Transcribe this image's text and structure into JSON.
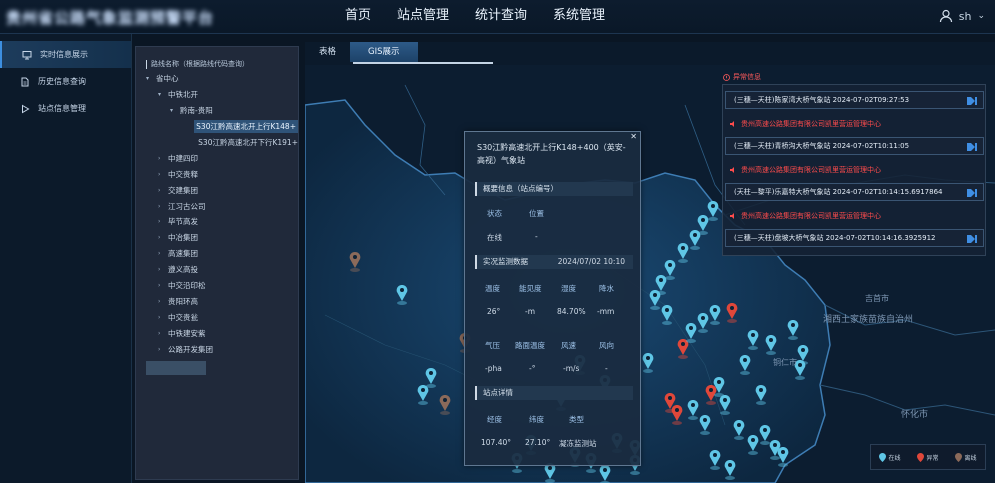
{
  "app": {
    "title": "贵州省公路气象监测预警平台"
  },
  "nav": {
    "items": [
      "首页",
      "站点管理",
      "统计查询",
      "系统管理"
    ]
  },
  "user": {
    "name": "sh"
  },
  "sidebar": {
    "items": [
      {
        "label": "实时信息展示",
        "icon": "monitor-icon"
      },
      {
        "label": "历史信息查询",
        "icon": "document-icon"
      },
      {
        "label": "站点信息管理",
        "icon": "play-icon"
      }
    ]
  },
  "tree": {
    "header": "路线名称（根据路线代码查询）",
    "nodes": [
      {
        "label": "省中心",
        "arrow": "▾"
      },
      {
        "label": "中铁北开",
        "arrow": "▾"
      },
      {
        "label": "黔南-贵阳",
        "arrow": "▾"
      },
      {
        "label": "S30江黔高速北开上行K148+",
        "arrow": ""
      },
      {
        "label": "S30江黔高速北开下行K191+",
        "arrow": ""
      },
      {
        "label": "中建四印",
        "arrow": "›"
      },
      {
        "label": "中交贵释",
        "arrow": "›"
      },
      {
        "label": "交建集团",
        "arrow": "›"
      },
      {
        "label": "江习古公司",
        "arrow": "›"
      },
      {
        "label": "毕节高发",
        "arrow": "›"
      },
      {
        "label": "中冶集团",
        "arrow": "›"
      },
      {
        "label": "高速集团",
        "arrow": "›"
      },
      {
        "label": "遵义高投",
        "arrow": "›"
      },
      {
        "label": "中交沿印松",
        "arrow": "›"
      },
      {
        "label": "贵阳环高",
        "arrow": "›"
      },
      {
        "label": "中交贵瓮",
        "arrow": "›"
      },
      {
        "label": "中铁建安紫",
        "arrow": "›"
      },
      {
        "label": "公路开发集团",
        "arrow": "›"
      }
    ]
  },
  "tabs": [
    "表格",
    "GIS展示"
  ],
  "alerts": {
    "title": "异常信息",
    "rows": [
      {
        "text": "(三穗—天柱)陈家湾大桥气象站 2024-07-02T09:27:53",
        "type": "dark"
      },
      {
        "text": "贵州高速公路集团有限公司凯里营运管理中心",
        "type": "red"
      },
      {
        "text": "(三穗—天柱)青桥沟大桥气象站 2024-07-02T10:11:05",
        "type": "dark"
      },
      {
        "text": "贵州高速公路集团有限公司凯里营运管理中心",
        "type": "red"
      },
      {
        "text": "(天柱—黎平)乐嘉特大桥气象站 2024-07-02T10:14:15.6917864",
        "type": "dark"
      },
      {
        "text": "贵州高速公路集团有限公司凯里营运管理中心",
        "type": "red"
      },
      {
        "text": "(三穗—天柱)盘坡大桥气象站 2024-07-02T10:14:16.3925912",
        "type": "dark"
      }
    ]
  },
  "popup": {
    "title": "S30江黔高速北开上行K148+400（英安-高视）气象站",
    "overview_label": "概要信息（站点编号）",
    "status_header": "状态",
    "location_header": "位置",
    "status_value": "在线",
    "location_value": "-",
    "monitor_label": "实况监测数据",
    "monitor_time": "2024/07/02 10:10",
    "row1_headers": [
      "温度",
      "能见度",
      "湿度",
      "降水"
    ],
    "row1_values": [
      "26°",
      "-m",
      "84.70%",
      "-mm"
    ],
    "row2_headers": [
      "气压",
      "路面温度",
      "风速",
      "风向"
    ],
    "row2_values": [
      "-pha",
      "-°",
      "-m/s",
      "-"
    ],
    "detail_label": "站点详情",
    "row3_headers": [
      "经度",
      "纬度",
      "类型"
    ],
    "row3_values": [
      "107.40°",
      "27.10°",
      "凝冻监测站"
    ]
  },
  "map": {
    "place_labels": [
      "吉首市",
      "湘西土家族苗族自治州",
      "铜仁市",
      "怀化市"
    ]
  },
  "legend": {
    "items": [
      {
        "label": "在线",
        "color": "#5fc6e6"
      },
      {
        "label": "异常",
        "color": "#e0473a"
      },
      {
        "label": "离线",
        "color": "#8b6a5a"
      }
    ]
  },
  "colors": {
    "accent": "#2d5a88",
    "alert": "#ff4c4c",
    "online": "#5fc6e6",
    "abnormal": "#e0473a",
    "offline": "#8b6a5a"
  }
}
